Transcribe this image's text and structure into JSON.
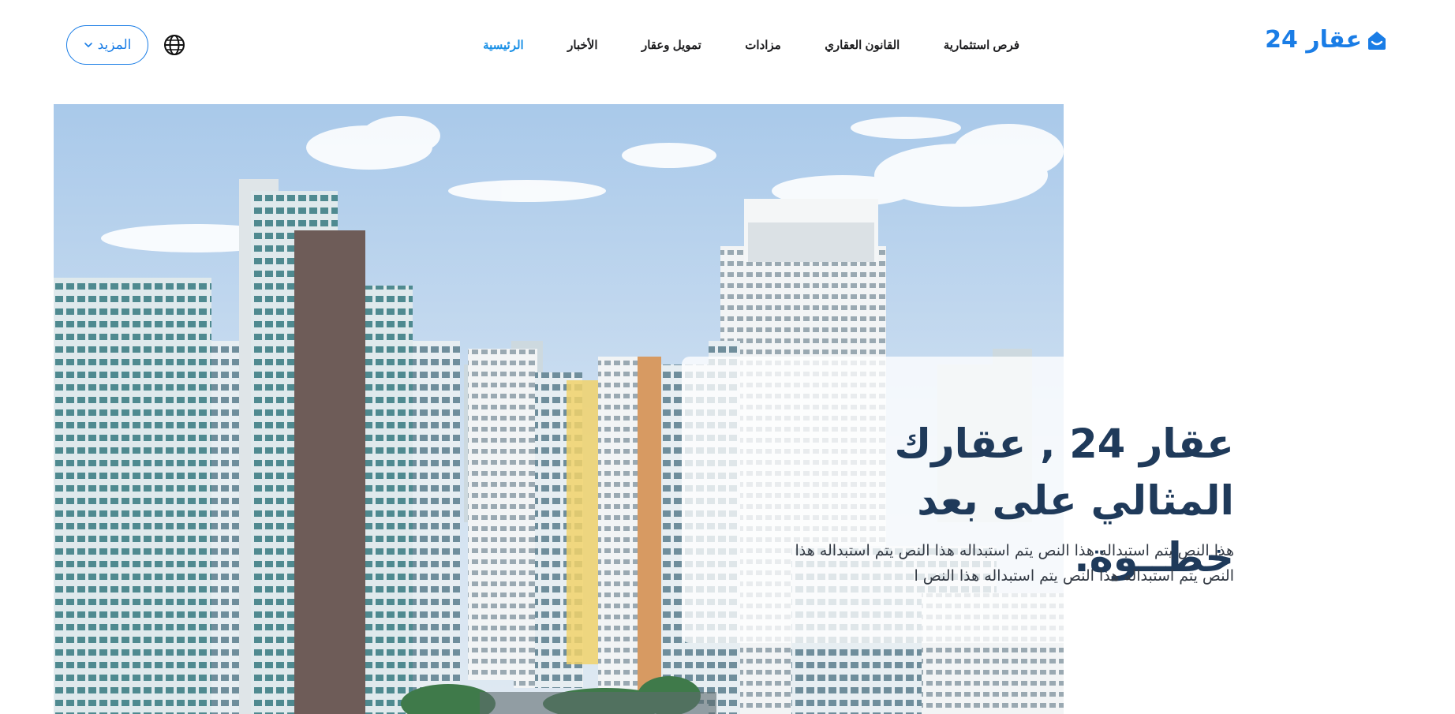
{
  "header": {
    "brand": {
      "name": "عقار 24",
      "icon": "house-icon",
      "color": "#1a7de6"
    },
    "nav": [
      {
        "label": "الرئيسية",
        "active": true
      },
      {
        "label": "الأخبار",
        "active": false
      },
      {
        "label": "تمويل وعقار",
        "active": false
      },
      {
        "label": "مزادات",
        "active": false
      },
      {
        "label": "القانون العقاري",
        "active": false
      },
      {
        "label": "فرص استثمارية",
        "active": false
      }
    ],
    "language_icon": "globe-icon",
    "more_button": {
      "label": "المزيد",
      "icon": "chevron-down-icon"
    },
    "active_color": "#1a90e6"
  },
  "hero": {
    "image": "city-skyline-photo",
    "title": "عقار 24 , عقارك المثالي على بعد خطــوة.",
    "text": "هذا النص يتم استبداله هذا النص يتم استبداله هذا النص يتم استبداله هذا النص يتم استبداله هذا النص يتم استبداله هذا النص ا",
    "title_color": "#1f3a5a"
  }
}
